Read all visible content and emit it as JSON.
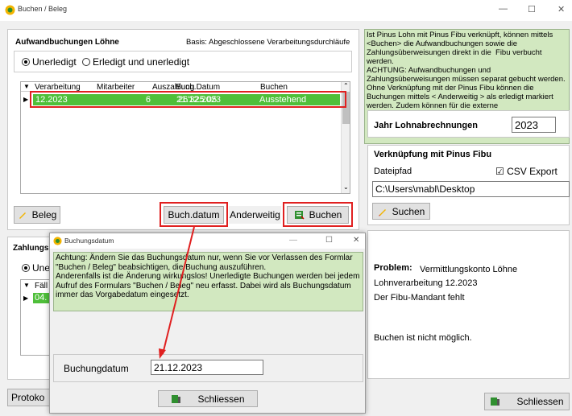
{
  "window": {
    "title": "Buchen / Beleg",
    "minimize": "—",
    "maximize": "☐",
    "close": "✕"
  },
  "left": {
    "section_title": "Aufwandbuchungen Löhne",
    "basis": "Basis: Abgeschlossene Verarbeitungsdurchläufe",
    "radio_unerledigt": "Unerledigt",
    "radio_erledigt": "Erledigt und unerledigt",
    "columns": [
      "Verarbeitung",
      "Mitarbeiter",
      "Auszahlung",
      "Buch.Datum",
      "Buchen"
    ],
    "rows": [
      {
        "verarbeitung": "12.2023",
        "mitarbeiter": "6",
        "auszahlung": "26'325.05",
        "buch_datum": "21.12.2023",
        "buchen": "Ausstehend"
      }
    ],
    "beleg_button": "Beleg",
    "buchdatum_button": "Buch.datum",
    "anderweitig_button": "Anderweitig",
    "buchen_button": "Buchen",
    "zahlungs_title": "Zahlungs",
    "zahlungs_radio": "Une",
    "zahlungs_col": "Fäll",
    "zahlungs_row": "04.",
    "protokoll_button": "Protoko"
  },
  "right": {
    "info_text": "Ist Pinus Lohn mit Pinus Fibu verknüpft, können mittels <Buchen> die Aufwandbuchungen sowie die Zahlungsüberweisungen direkt in die  Fibu verbucht werden.\nACHTUNG: Aufwandbuchungen und Zahlungsüberweisungen müssen separat gebucht werden. Ohne Verknüpfung mit der Pinus Fibu können die Buchungen mittels < Anderweitig > als erledigt markiert werden. Zudem können für die externe",
    "jahr_label": "Jahr Lohnabrechnungen",
    "jahr_value": "2023",
    "verknuepfung_title": "Verknüpfung mit Pinus Fibu",
    "dateipfad_label": "Dateipfad",
    "csv_label": "CSV Export",
    "path_value": "C:\\Users\\mabl\\Desktop",
    "suchen_button": "Suchen",
    "problem_label": "Problem:",
    "problem_value": "Vermittlungskonto Löhne",
    "line1": "Lohnverarbeitung 12.2023",
    "line2": "Der Fibu-Mandant fehlt",
    "status": "Buchen ist nicht möglich.",
    "schliessen_button": "Schliessen"
  },
  "dialog": {
    "title": "Buchungsdatum",
    "note": "Achtung: Ändern Sie das Buchungsdatum nur, wenn Sie vor Verlassen des Formlar \"Buchen / Beleg\" beabsichtigen, die Buchung auszuführen.\nAnderenfalls ist die Änderung wirkungslos! Unerledigte Buchungen werden bei jedem Aufruf des Formulars \"Buchen / Beleg\" neu erfasst. Dabei wird als Buchungsdatum immer das Vorgabedatum eingesetzt.",
    "field_label": "Buchungdatum",
    "field_value": "21.12.2023",
    "schliessen_button": "Schliessen"
  },
  "colors": {
    "row_green": "#4fbf3a",
    "note_green": "#d2e8c0",
    "highlight": "#e02020"
  }
}
